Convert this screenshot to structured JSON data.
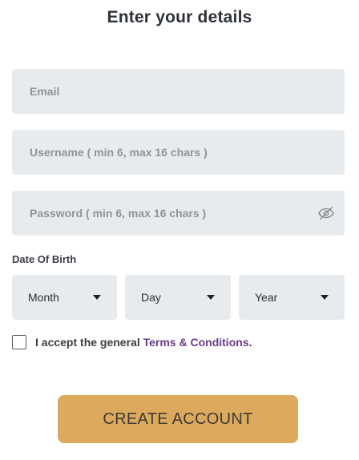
{
  "header": {
    "title": "Enter your details"
  },
  "form": {
    "email": {
      "placeholder": "Email",
      "value": ""
    },
    "username": {
      "placeholder": "Username ( min 6, max 16 chars )",
      "value": ""
    },
    "password": {
      "placeholder": "Password ( min 6, max 16 chars )",
      "value": "",
      "toggle_icon": "eye-slash-icon"
    },
    "dob": {
      "label": "Date Of Birth",
      "month": "Month",
      "day": "Day",
      "year": "Year"
    },
    "terms": {
      "prefix": "I accept the general ",
      "link": "Terms & Conditions",
      "suffix": ".",
      "checked": false
    },
    "submit_label": "CREATE ACCOUNT"
  },
  "colors": {
    "field_bg": "#e8ebee",
    "button_bg": "#dbaa5e",
    "link": "#6a3a8a"
  }
}
